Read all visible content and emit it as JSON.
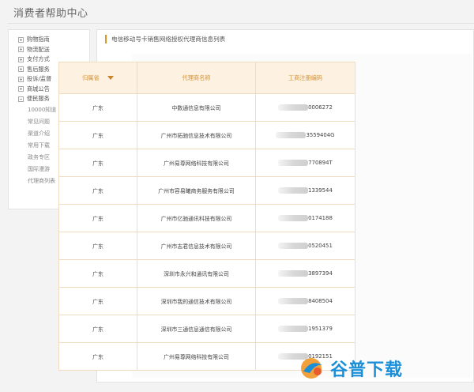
{
  "header": {
    "title": "消费者帮助中心"
  },
  "sidebar": {
    "items": [
      {
        "label": "购物指南"
      },
      {
        "label": "物流配送"
      },
      {
        "label": "支付方式"
      },
      {
        "label": "售后服务"
      },
      {
        "label": "投诉/监督"
      },
      {
        "label": "商城公告"
      },
      {
        "label": "便民服务"
      }
    ],
    "sub_items": [
      {
        "label": "10000知道"
      },
      {
        "label": "常见问题"
      },
      {
        "label": "渠道介绍"
      },
      {
        "label": "常用下载"
      },
      {
        "label": "政务专区"
      },
      {
        "label": "国际漫游"
      },
      {
        "label": "代理商列表"
      }
    ]
  },
  "main": {
    "heading": "电信移动号卡销售网络授权代理商信息列表",
    "table": {
      "headers": {
        "region": "归属省",
        "agent": "代理商名称",
        "code": "工商注册编码"
      },
      "rows": [
        {
          "region": "广东",
          "agent": "中数通信息有限公司",
          "code": "0006272"
        },
        {
          "region": "广东",
          "agent": "广州市拓驰信息技术有限公司",
          "code": "3559404G"
        },
        {
          "region": "广东",
          "agent": "广州易尊网络科技有限公司",
          "code": "770894T"
        },
        {
          "region": "广东",
          "agent": "广州市容易曦商务服务有限公司",
          "code": "1339544"
        },
        {
          "region": "广东",
          "agent": "广州市亿驰通讯科技有限公司",
          "code": "0174188"
        },
        {
          "region": "广东",
          "agent": "广州市志君信息技术有限公司",
          "code": "0520451"
        },
        {
          "region": "广东",
          "agent": "深圳市永兴和通讯有限公司",
          "code": "3897394"
        },
        {
          "region": "广东",
          "agent": "深圳市我的通信技术有限公司",
          "code": "8408504"
        },
        {
          "region": "广东",
          "agent": "深圳市三通信息通信有限公司",
          "code": "1951379"
        },
        {
          "region": "广东",
          "agent": "广州易尊网络科技有限公司",
          "code": "0192151"
        }
      ]
    }
  },
  "watermark": {
    "text": "谷普下载"
  },
  "colors": {
    "accent": "#d79a2a",
    "header_bg": "#fdf2e2",
    "watermark": "#1a8fd8"
  }
}
